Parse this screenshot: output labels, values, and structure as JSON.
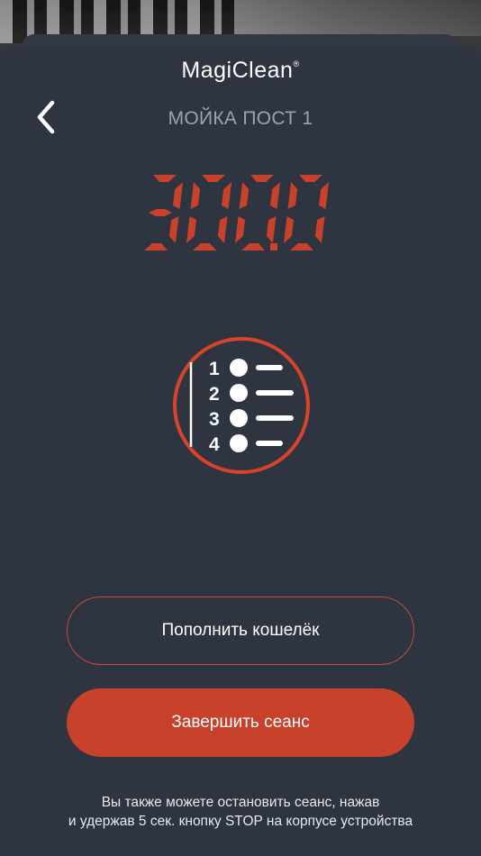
{
  "app": {
    "logo_text": "MagiClean",
    "logo_mark": "®"
  },
  "header": {
    "title": "МОЙКА ПОСТ 1",
    "back_icon": "chevron-left-icon"
  },
  "balance": {
    "display": "300.0",
    "color": "#c8412b"
  },
  "menu": {
    "icon": "program-list-icon",
    "items": [
      "1",
      "2",
      "3",
      "4"
    ]
  },
  "actions": {
    "topup_label": "Пополнить кошелёк",
    "end_label": "Завершить сеанс"
  },
  "hint": {
    "line1": "Вы также можете остановить сеанс, нажав",
    "line2": "и удержав 5 сек. кнопку STOP на корпусе устройства"
  },
  "colors": {
    "background": "#2e3440",
    "accent": "#c8412b",
    "muted_text": "#9ea3ab"
  }
}
